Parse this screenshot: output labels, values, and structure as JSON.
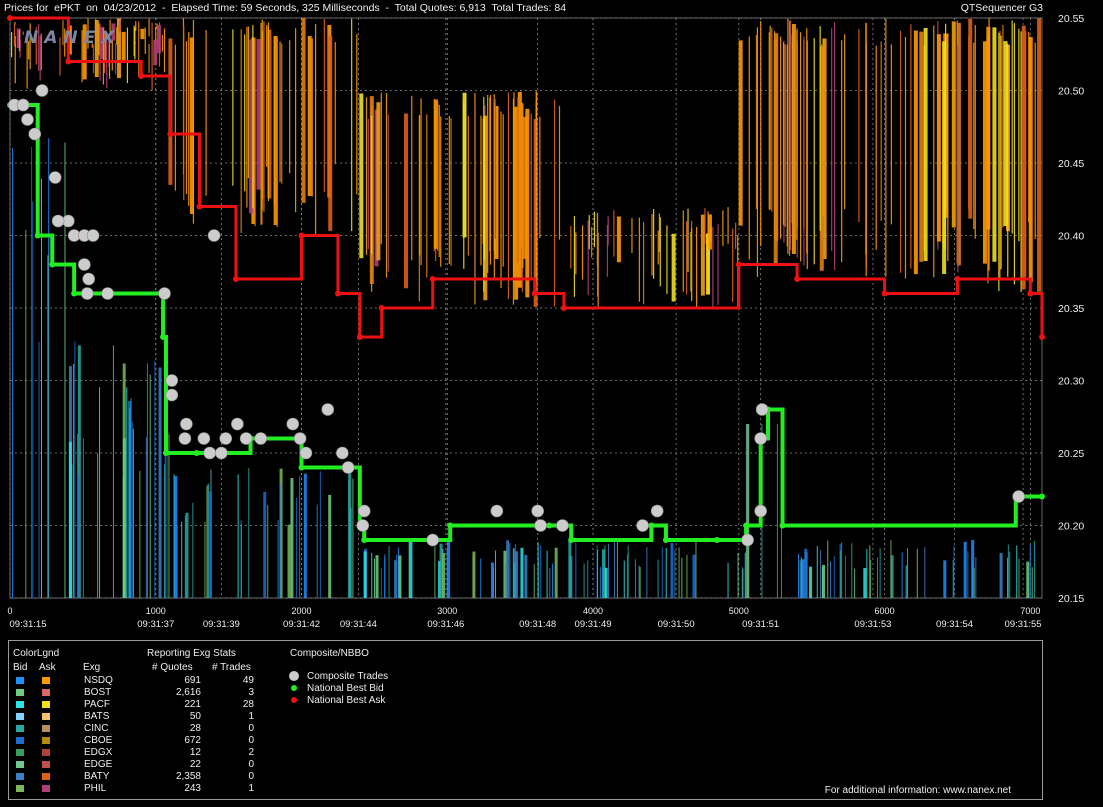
{
  "header": {
    "title": "Prices for  ePKT  on  04/23/2012  -  Elapsed Time: 59 Seconds, 325 Milliseconds  -  Total Quotes: 6,913  Total Trades: 84",
    "app": "QTSequencer G3",
    "watermark": "NANEX"
  },
  "chart_data": {
    "type": "line",
    "x_axis": {
      "ticks": [
        0,
        1000,
        2000,
        3000,
        4000,
        5000,
        6000,
        7000
      ],
      "range": [
        0,
        7080
      ]
    },
    "time_labels": [
      "09:31:15",
      "09:31:37",
      "09:31:39",
      "09:31:42",
      "09:31:44",
      "09:31:46",
      "09:31:48",
      "09:31:49",
      "09:31:50",
      "09:31:51",
      "09:31:53",
      "09:31:54",
      "09:31:55"
    ],
    "time_label_x": [
      0,
      1000,
      1450,
      2000,
      2390,
      2990,
      3620,
      4000,
      4570,
      5150,
      5920,
      6480,
      6950
    ],
    "y_axis": {
      "ticks": [
        "20.15",
        "20.20",
        "20.25",
        "20.30",
        "20.35",
        "20.40",
        "20.45",
        "20.50",
        "20.55"
      ],
      "range": [
        20.15,
        20.55
      ]
    },
    "colors": {
      "bid": "#22ee22",
      "ask": "#ee1111",
      "trade": "#cccccc",
      "grid": "#8a8a8a"
    },
    "series": [
      {
        "name": "National Best Bid",
        "step": [
          [
            0,
            20.49
          ],
          [
            190,
            20.4
          ],
          [
            290,
            20.38
          ],
          [
            440,
            20.36
          ],
          [
            1050,
            20.33
          ],
          [
            1070,
            20.25
          ],
          [
            1280,
            20.25
          ],
          [
            1650,
            20.26
          ],
          [
            2000,
            20.24
          ],
          [
            2400,
            20.2
          ],
          [
            2430,
            20.19
          ],
          [
            3020,
            20.2
          ],
          [
            3700,
            20.2
          ],
          [
            3850,
            20.19
          ],
          [
            4400,
            20.2
          ],
          [
            4500,
            20.19
          ],
          [
            4850,
            20.19
          ],
          [
            5050,
            20.2
          ],
          [
            5150,
            20.26
          ],
          [
            5200,
            20.28
          ],
          [
            5300,
            20.2
          ],
          [
            6900,
            20.22
          ],
          [
            7080,
            20.22
          ]
        ]
      },
      {
        "name": "National Best Ask",
        "step": [
          [
            0,
            20.55
          ],
          [
            400,
            20.52
          ],
          [
            900,
            20.51
          ],
          [
            1100,
            20.47
          ],
          [
            1300,
            20.42
          ],
          [
            1550,
            20.37
          ],
          [
            2000,
            20.4
          ],
          [
            2250,
            20.36
          ],
          [
            2400,
            20.33
          ],
          [
            2550,
            20.35
          ],
          [
            2900,
            20.37
          ],
          [
            3600,
            20.36
          ],
          [
            3800,
            20.35
          ],
          [
            5000,
            20.38
          ],
          [
            5400,
            20.37
          ],
          [
            6000,
            20.36
          ],
          [
            6500,
            20.37
          ],
          [
            7000,
            20.36
          ],
          [
            7080,
            20.33
          ]
        ]
      }
    ],
    "trades": [
      [
        30,
        20.49
      ],
      [
        90,
        20.49
      ],
      [
        220,
        20.5
      ],
      [
        120,
        20.48
      ],
      [
        170,
        20.47
      ],
      [
        310,
        20.44
      ],
      [
        400,
        20.41
      ],
      [
        330,
        20.41
      ],
      [
        440,
        20.4
      ],
      [
        510,
        20.4
      ],
      [
        570,
        20.4
      ],
      [
        510,
        20.38
      ],
      [
        540,
        20.37
      ],
      [
        530,
        20.36
      ],
      [
        670,
        20.36
      ],
      [
        1060,
        20.36
      ],
      [
        1400,
        20.4
      ],
      [
        1110,
        20.3
      ],
      [
        1110,
        20.29
      ],
      [
        1210,
        20.27
      ],
      [
        1200,
        20.26
      ],
      [
        1330,
        20.26
      ],
      [
        1370,
        20.25
      ],
      [
        1450,
        20.25
      ],
      [
        1480,
        20.26
      ],
      [
        1560,
        20.27
      ],
      [
        1620,
        20.26
      ],
      [
        1720,
        20.26
      ],
      [
        1940,
        20.27
      ],
      [
        1990,
        20.26
      ],
      [
        2030,
        20.25
      ],
      [
        2180,
        20.28
      ],
      [
        2280,
        20.25
      ],
      [
        2320,
        20.24
      ],
      [
        2430,
        20.21
      ],
      [
        2420,
        20.2
      ],
      [
        2900,
        20.19
      ],
      [
        3340,
        20.21
      ],
      [
        3620,
        20.21
      ],
      [
        3640,
        20.2
      ],
      [
        3790,
        20.2
      ],
      [
        4340,
        20.2
      ],
      [
        4440,
        20.21
      ],
      [
        5060,
        20.19
      ],
      [
        5160,
        20.28
      ],
      [
        5150,
        20.26
      ],
      [
        5150,
        20.21
      ],
      [
        6920,
        20.22
      ]
    ],
    "legend": {
      "bid": "Bid",
      "ask": "Ask"
    }
  },
  "legend_panel": {
    "title": "ColorLgnd",
    "bid_label": "Bid",
    "ask_label": "Ask",
    "exg_header": "Exg",
    "stats_title": "Reporting Exg Stats",
    "quotes_header": "# Quotes",
    "trades_header": "# Trades",
    "rows": [
      {
        "exg": "NSDQ",
        "quotes": "691",
        "trades": "49",
        "bid": "#1e90ff",
        "ask": "#ff9900"
      },
      {
        "exg": "BOST",
        "quotes": "2,616",
        "trades": "3",
        "bid": "#6fcf80",
        "ask": "#d86a6a"
      },
      {
        "exg": "PACF",
        "quotes": "221",
        "trades": "28",
        "bid": "#2ee6e6",
        "ask": "#f0e020"
      },
      {
        "exg": "BATS",
        "quotes": "50",
        "trades": "1",
        "bid": "#7fd4ff",
        "ask": "#f8c070"
      },
      {
        "exg": "CINC",
        "quotes": "28",
        "trades": "0",
        "bid": "#28a8a0",
        "ask": "#b89060"
      },
      {
        "exg": "CBOE",
        "quotes": "672",
        "trades": "0",
        "bid": "#1a6fd0",
        "ask": "#b88a10"
      },
      {
        "exg": "EDGX",
        "quotes": "12",
        "trades": "2",
        "bid": "#3aa060",
        "ask": "#b04040"
      },
      {
        "exg": "EDGE",
        "quotes": "22",
        "trades": "0",
        "bid": "#70c890",
        "ask": "#c05050"
      },
      {
        "exg": "BATY",
        "quotes": "2,358",
        "trades": "0",
        "bid": "#3d80c8",
        "ask": "#e06018"
      },
      {
        "exg": "PHIL",
        "quotes": "243",
        "trades": "1",
        "bid": "#78b858",
        "ask": "#b04078"
      }
    ],
    "composite_title": "Composite/NBBO",
    "composite_items": [
      {
        "label": "Composite Trades",
        "color": "#cccccc"
      },
      {
        "label": "National Best Bid",
        "color": "#22ee22"
      },
      {
        "label": "National Best Ask",
        "color": "#ee1111"
      }
    ],
    "footer": "For additional information: www.nanex.net"
  }
}
